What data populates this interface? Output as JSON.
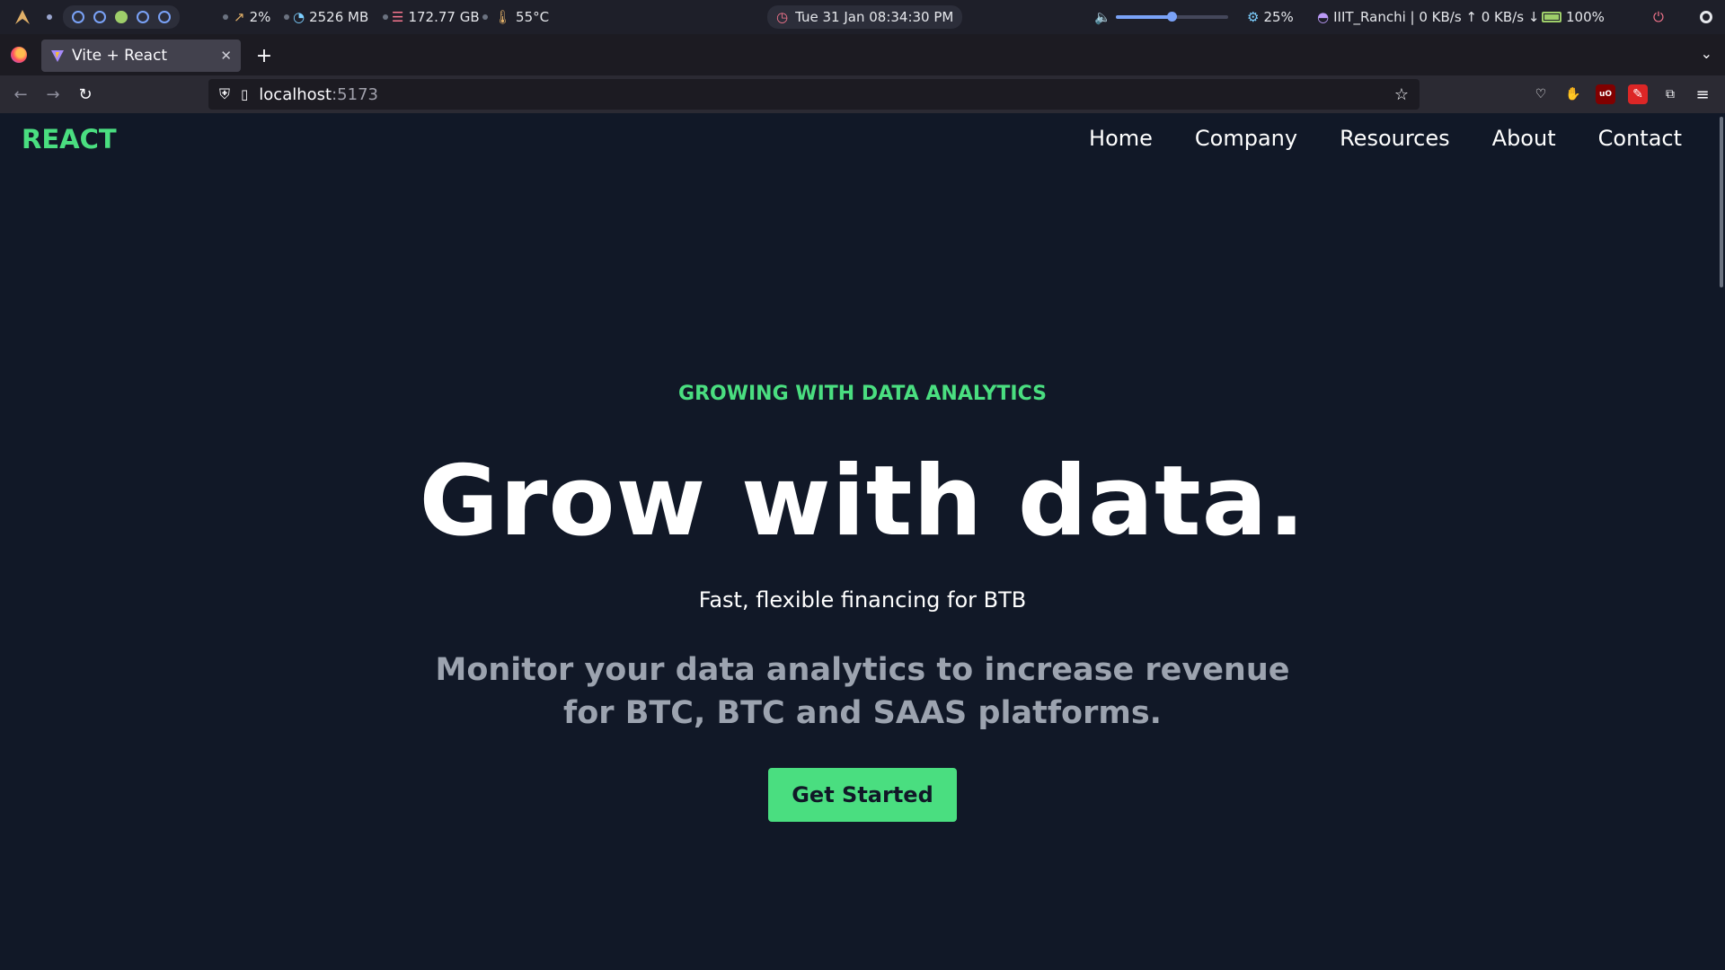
{
  "system_bar": {
    "workspaces": [
      false,
      false,
      true,
      false,
      false
    ],
    "cpu": "2%",
    "memory": "2526 MB",
    "disk": "172.77 GB",
    "temperature": "55°C",
    "clock": "Tue 31 Jan 08:34:30 PM",
    "volume_level": 0.5,
    "brightness": "25%",
    "network": "IIIT_Ranchi | 0 KB/s ↑ 0 KB/s ↓",
    "battery": "100%"
  },
  "browser": {
    "tab_title": "Vite + React",
    "url_host": "localhost",
    "url_port": ":5173"
  },
  "site": {
    "brand": "REACT",
    "nav": [
      "Home",
      "Company",
      "Resources",
      "About",
      "Contact"
    ],
    "eyebrow": "GROWING WITH DATA ANALYTICS",
    "headline": "Grow with data.",
    "subline": "Fast, flexible financing for BTB",
    "description": "Monitor your data analytics to increase revenue for BTC, BTC and SAAS platforms.",
    "cta": "Get Started"
  },
  "colors": {
    "accent": "#4ade80",
    "background": "#111827",
    "muted_text": "#9ca3af"
  },
  "icons": [
    "arch-logo-icon",
    "cpu-icon",
    "memory-icon",
    "disk-icon",
    "thermometer-icon",
    "clock-icon",
    "volume-icon",
    "brightness-icon",
    "wifi-icon",
    "battery-icon",
    "power-icon",
    "firefox-icon",
    "back-icon",
    "forward-icon",
    "reload-icon",
    "shield-icon",
    "page-icon",
    "star-icon",
    "pocket-icon",
    "extension-icon",
    "menu-icon"
  ]
}
